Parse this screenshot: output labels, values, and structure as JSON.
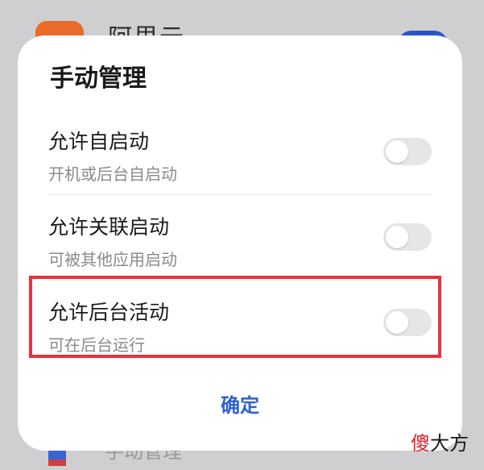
{
  "background": {
    "app_name": "阿里云",
    "bottom_item": "手动管理"
  },
  "dialog": {
    "title": "手动管理",
    "settings": [
      {
        "title": "允许自启动",
        "description": "开机或后台自启动",
        "enabled": false
      },
      {
        "title": "允许关联启动",
        "description": "可被其他应用启动",
        "enabled": false
      },
      {
        "title": "允许后台活动",
        "description": "可在后台运行",
        "enabled": false
      }
    ],
    "confirm_label": "确定"
  },
  "watermark": {
    "first": "傻",
    "rest": "大方"
  },
  "colors": {
    "accent": "#2f60d0",
    "highlight": "#e8323c",
    "toggle_off": "#e6e6e6"
  }
}
